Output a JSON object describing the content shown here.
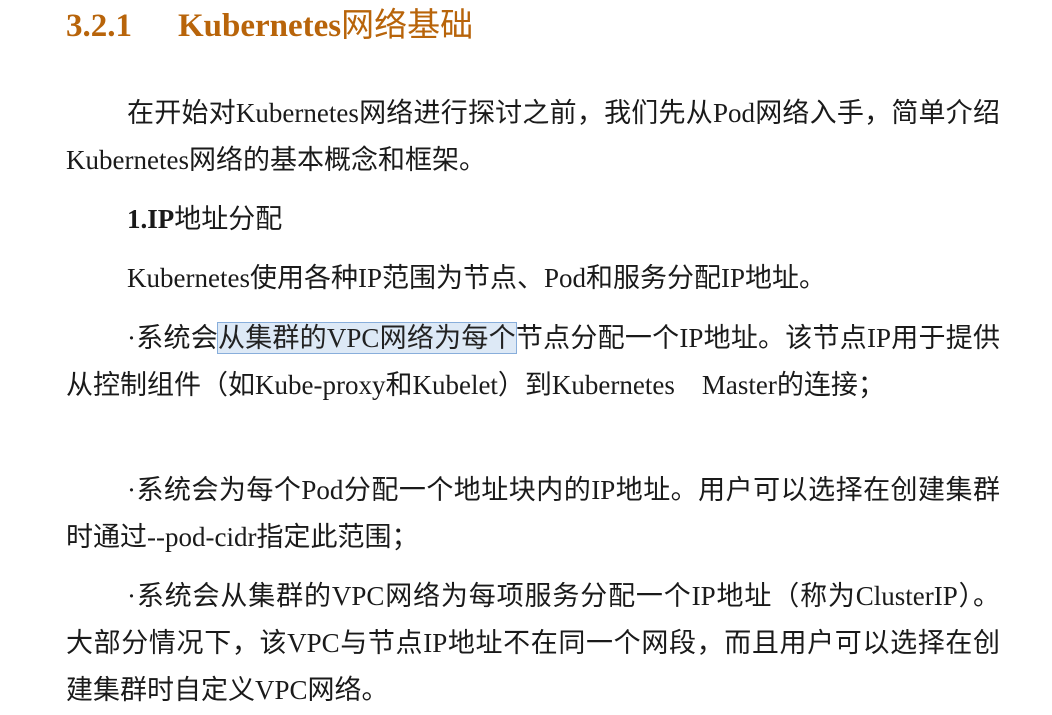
{
  "section": {
    "number": "3.2.1",
    "title_en": "Kubernetes",
    "title_zh": "网络基础"
  },
  "paragraphs": {
    "intro": "在开始对Kubernetes网络进行探讨之前，我们先从Pod网络入手，简单介绍Kubernetes网络的基本概念和框架。",
    "subheading_label": "1.IP",
    "subheading_text": "地址分配",
    "ip_ranges": "Kubernetes使用各种IP范围为节点、Pod和服务分配IP地址。",
    "bullet1_pre": "·系统会",
    "bullet1_highlight": "从集群的VPC网络为每个",
    "bullet1_post": "节点分配一个IP地址。该节点IP用于提供从控制组件（如Kube-proxy和Kubelet）到Kubernetes　Master的连接；",
    "bullet2": "·系统会为每个Pod分配一个地址块内的IP地址。用户可以选择在创建集群时通过--pod-cidr指定此范围；",
    "bullet3": "·系统会从集群的VPC网络为每项服务分配一个IP地址（称为ClusterIP）。大部分情况下，该VPC与节点IP地址不在同一个网段，而且用户可以选择在创建集群时自定义VPC网络。"
  },
  "colors": {
    "heading": "#b8640a",
    "highlight_fill": "#dde9f6",
    "highlight_border": "#88aedb",
    "text": "#1a1a1a"
  }
}
